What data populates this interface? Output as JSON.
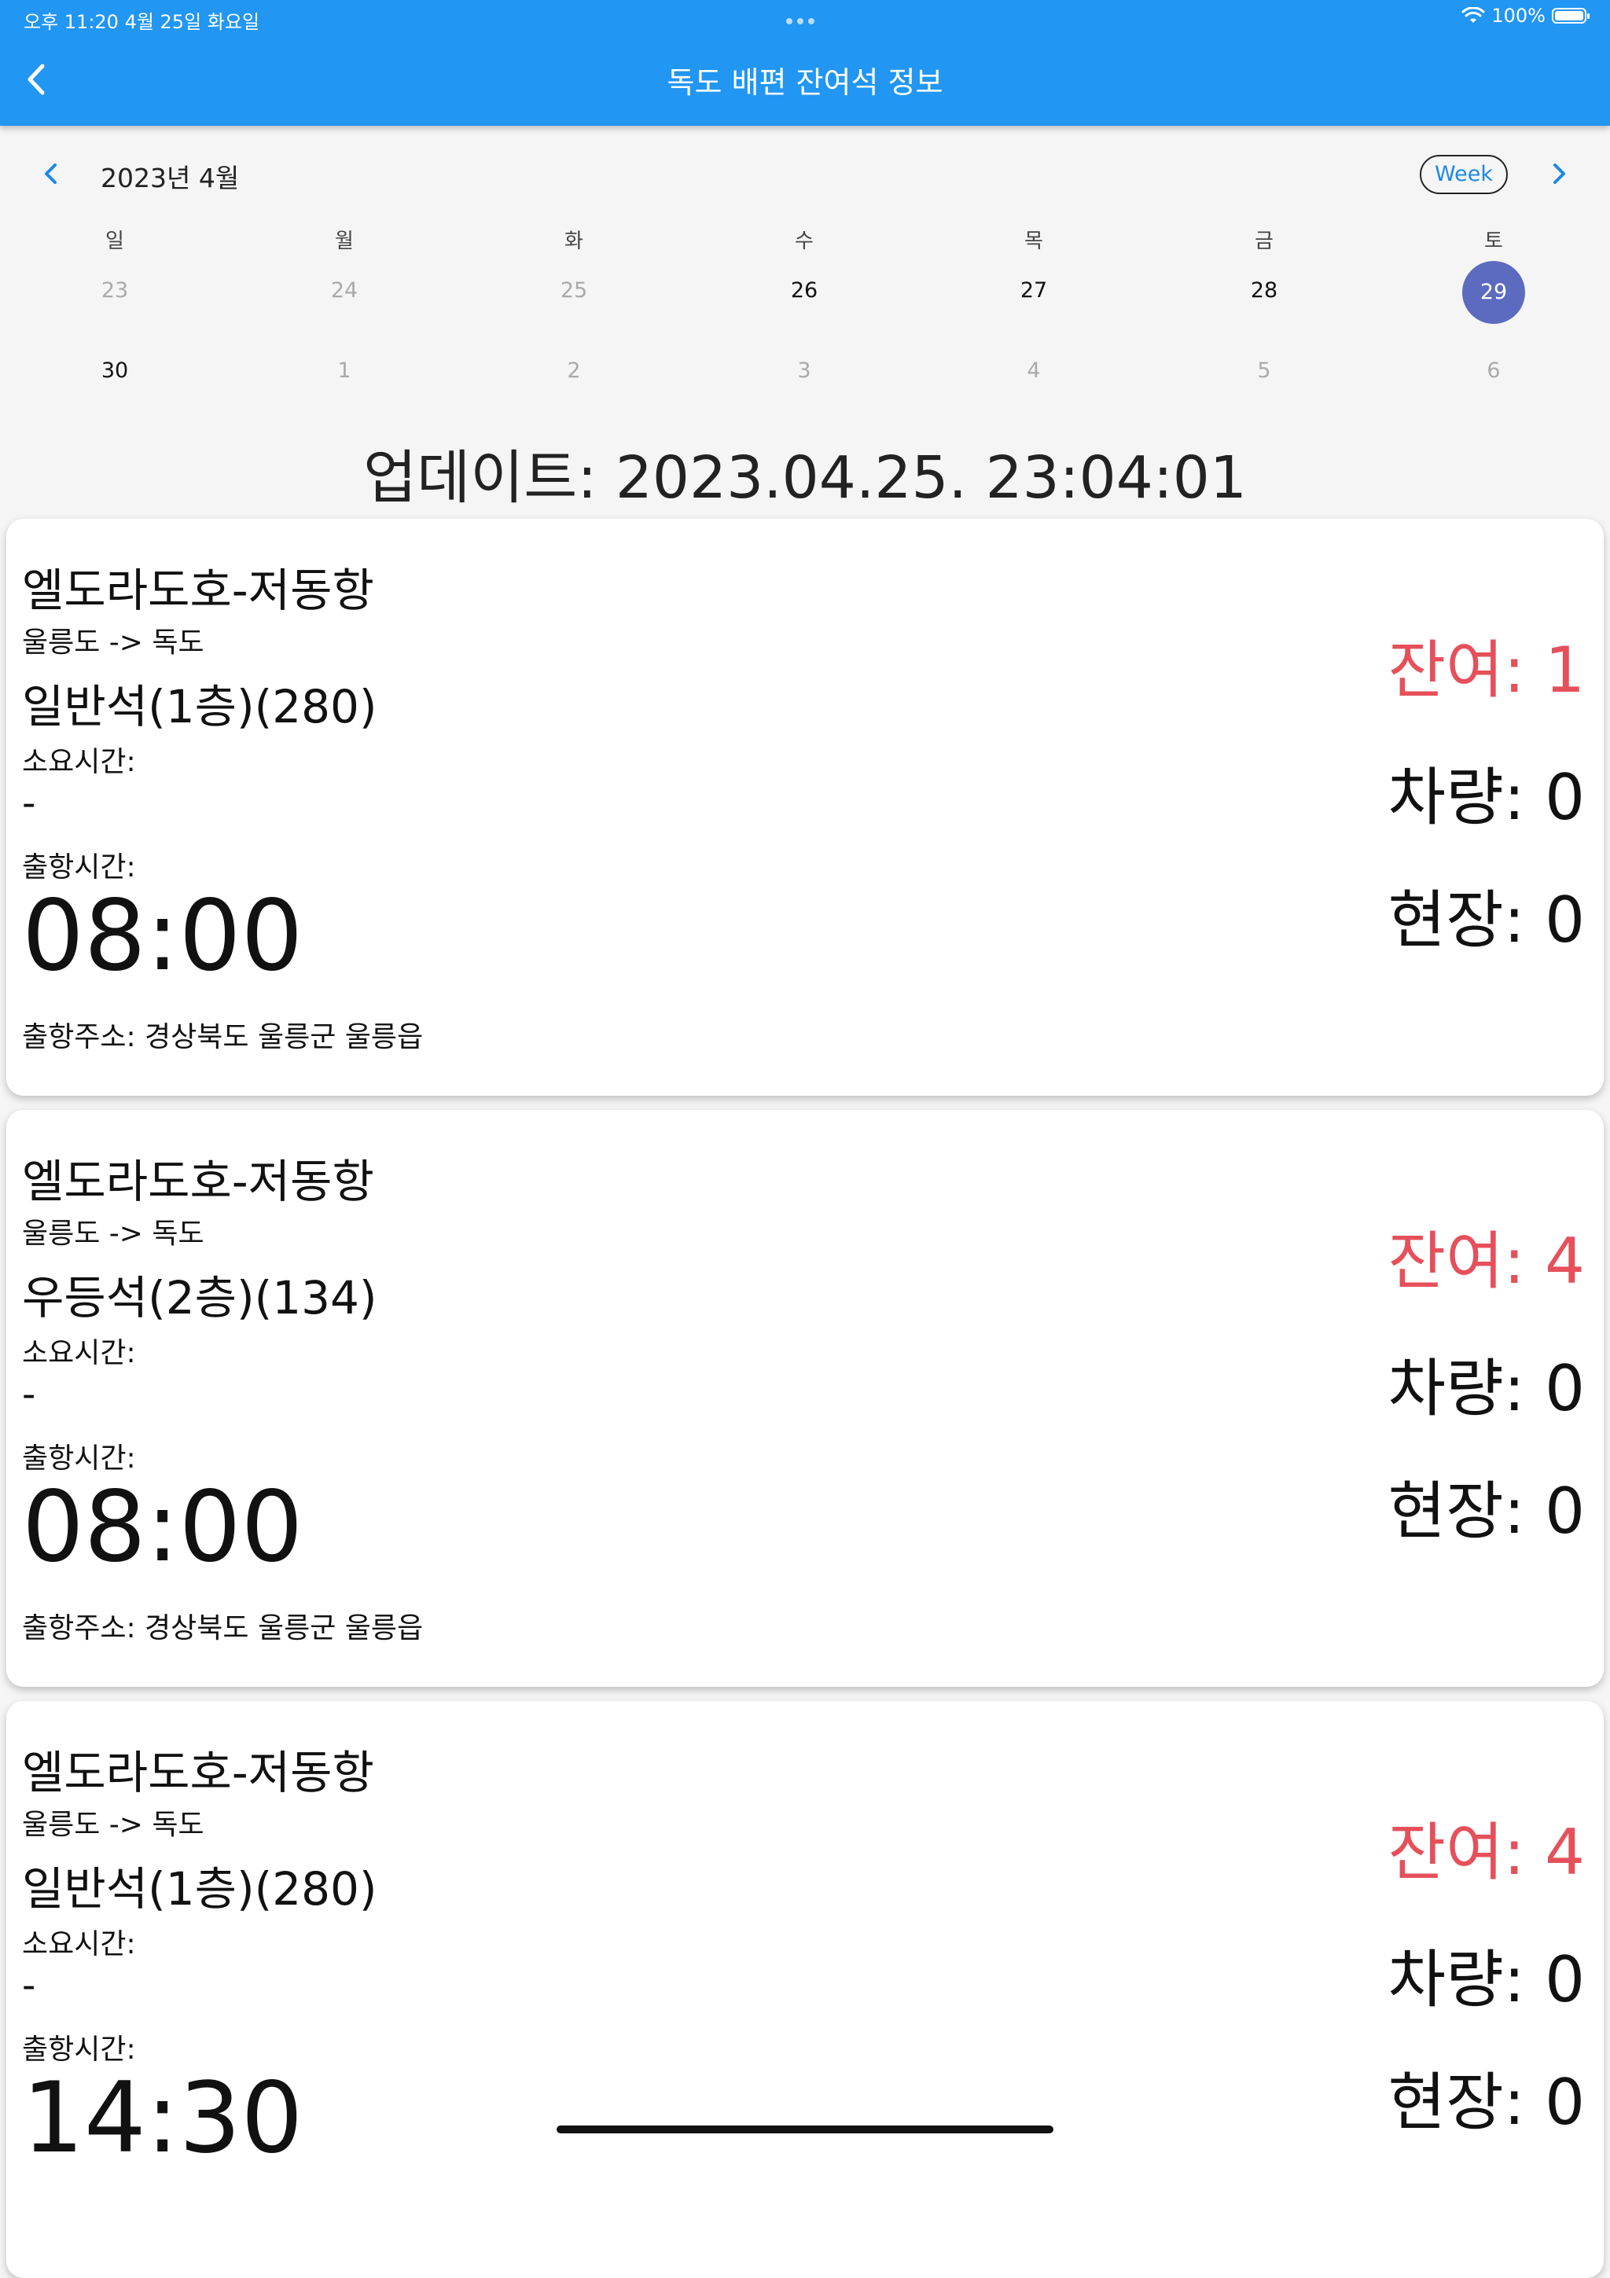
{
  "status_bar": {
    "time_date": "오후 11:20   4월 25일 화요일",
    "battery": "100%"
  },
  "app_bar": {
    "title": "독도 배편 잔여석 정보"
  },
  "calendar": {
    "month": "2023년 4월",
    "format_button": "Week",
    "days_of_week": [
      "일",
      "월",
      "화",
      "수",
      "목",
      "금",
      "토"
    ],
    "weeks": [
      [
        {
          "d": "23",
          "muted": true
        },
        {
          "d": "24",
          "muted": true
        },
        {
          "d": "25",
          "muted": true
        },
        {
          "d": "26",
          "muted": false
        },
        {
          "d": "27",
          "muted": false
        },
        {
          "d": "28",
          "muted": false
        },
        {
          "d": "29",
          "muted": false,
          "selected": true
        }
      ],
      [
        {
          "d": "30",
          "muted": false
        },
        {
          "d": "1",
          "muted": true
        },
        {
          "d": "2",
          "muted": true
        },
        {
          "d": "3",
          "muted": true
        },
        {
          "d": "4",
          "muted": true
        },
        {
          "d": "5",
          "muted": true
        },
        {
          "d": "6",
          "muted": true
        }
      ]
    ],
    "selected_color": "#5c6bc0"
  },
  "update": {
    "text": "업데이트: 2023.04.25. 23:04:01"
  },
  "cards": [
    {
      "title": "엘도라도호-저동항",
      "route": "울릉도 -> 독도",
      "seat": "일반석(1층)(280)",
      "duration_label": "소요시간:",
      "duration": "-",
      "departure_label": "출항시간:",
      "departure_time": "08:00",
      "address": "출항주소: 경상북도 울릉군 울릉읍",
      "remaining": "잔여: 1",
      "vehicle": "차량: 0",
      "onsite": "현장: 0"
    },
    {
      "title": "엘도라도호-저동항",
      "route": "울릉도 -> 독도",
      "seat": "우등석(2층)(134)",
      "duration_label": "소요시간:",
      "duration": "-",
      "departure_label": "출항시간:",
      "departure_time": "08:00",
      "address": "출항주소: 경상북도 울릉군 울릉읍",
      "remaining": "잔여: 4",
      "vehicle": "차량: 0",
      "onsite": "현장: 0"
    },
    {
      "title": "엘도라도호-저동항",
      "route": "울릉도 -> 독도",
      "seat": "일반석(1층)(280)",
      "duration_label": "소요시간:",
      "duration": "-",
      "departure_label": "출항시간:",
      "departure_time": "14:30",
      "address": "",
      "remaining": "잔여: 4",
      "vehicle": "차량: 0",
      "onsite": "현장: 0"
    }
  ],
  "colors": {
    "app_bar": "#2196f3",
    "remaining": "#e5505a",
    "week_button_text": "#1e88e5"
  }
}
